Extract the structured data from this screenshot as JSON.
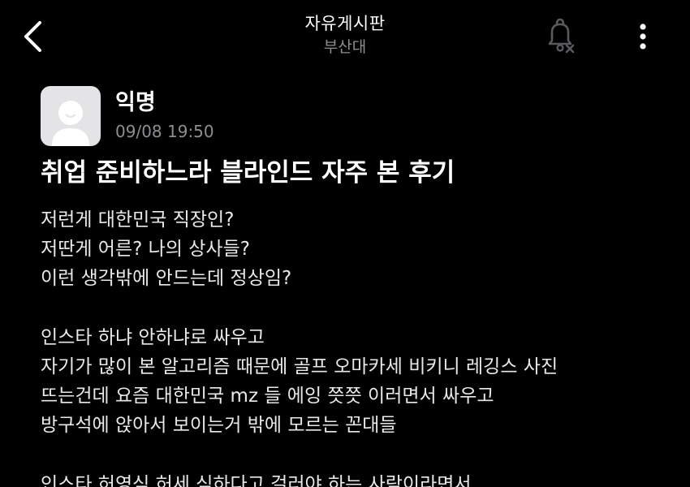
{
  "header": {
    "title": "자유게시판",
    "subtitle": "부산대",
    "back_icon": "chevron-left-icon",
    "bell_icon": "bell-off-icon",
    "more_icon": "more-vertical-icon"
  },
  "post": {
    "author": "익명",
    "time": "09/08 19:50",
    "title": "취업 준비하느라 블라인드 자주 본 후기",
    "body_lines": [
      "저런게 대한민국 직장인?",
      "저딴게 어른? 나의 상사들?",
      "이런 생각밖에 안드는데 정상임?",
      "",
      "인스타 하냐 안하냐로 싸우고",
      "자기가 많이 본 알고리즘 때문에 골프 오마카세 비키니 레깅스 사진",
      "뜨는건데 요즘 대한민국 mz 들 에잉 쯧쯧 이러면서 싸우고",
      "방구석에 앉아서 보이는거 밖에 모르는 꼰대들",
      "",
      "인스타 허영심 허세 심하다고 걸러야 하는 사람이라면서"
    ]
  },
  "colors": {
    "background": "#000000",
    "text_primary": "#ffffff",
    "text_secondary": "#8e8e93",
    "icon_muted": "#5a5a5e",
    "avatar_bg": "#e4e4e6",
    "avatar_figure": "#ffffff"
  }
}
